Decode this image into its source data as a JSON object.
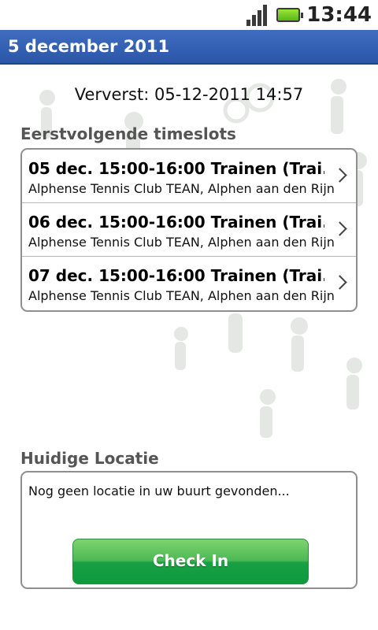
{
  "status_bar": {
    "time": "13:44",
    "signal_icon": "signal-strength-icon",
    "battery_icon": "battery-icon"
  },
  "header": {
    "title": "5 december 2011",
    "color": "#2f5cb0"
  },
  "refresh": {
    "text": "Ververst: 05-12-2011 14:57"
  },
  "timeslots": {
    "heading": "Eerstvolgende timeslots",
    "items": [
      {
        "title": "05 dec. 15:00-16:00 Trainen (Trai...",
        "subtitle": "Alphense Tennis Club TEAN, Alphen aan den Rijn"
      },
      {
        "title": "06 dec. 15:00-16:00 Trainen (Trai...",
        "subtitle": "Alphense Tennis Club TEAN, Alphen aan den Rijn"
      },
      {
        "title": "07 dec. 15:00-16:00 Trainen (Trai...",
        "subtitle": "Alphense Tennis Club TEAN, Alphen aan den Rijn"
      }
    ]
  },
  "location": {
    "heading": "Huidige Locatie",
    "message": "Nog geen locatie in uw buurt gevonden...",
    "button_label": "Check In",
    "button_color": "#1aa046"
  }
}
